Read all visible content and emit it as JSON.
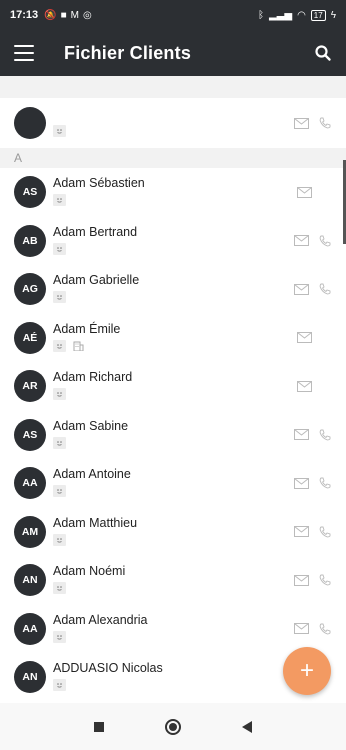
{
  "statusbar": {
    "time": "17:13",
    "battery": "17"
  },
  "appbar": {
    "title": "Fichier Clients"
  },
  "sections": {
    "a": "A"
  },
  "contacts": [
    {
      "initials": "AS",
      "name": "Adam Sébastien"
    },
    {
      "initials": "AB",
      "name": "Adam Bertrand"
    },
    {
      "initials": "AG",
      "name": "Adam Gabrielle"
    },
    {
      "initials": "AÉ",
      "name": "Adam Émile"
    },
    {
      "initials": "AR",
      "name": "Adam Richard"
    },
    {
      "initials": "AS",
      "name": "Adam Sabine"
    },
    {
      "initials": "AA",
      "name": "Adam Antoine"
    },
    {
      "initials": "AM",
      "name": "Adam Matthieu"
    },
    {
      "initials": "AN",
      "name": "Adam Noémi"
    },
    {
      "initials": "AA",
      "name": "Adam Alexandria"
    },
    {
      "initials": "AN",
      "name": "ADDUASIO Nicolas"
    }
  ],
  "fab": {
    "label": "+"
  },
  "icons": {
    "menu": "menu-icon",
    "search": "search-icon",
    "mail": "mail-icon",
    "phone": "phone-icon",
    "badge": "person-badge-icon",
    "company": "building-icon"
  },
  "colors": {
    "appbar": "#2c2f33",
    "fab": "#f39a62",
    "avatar": "#2c2f33"
  }
}
